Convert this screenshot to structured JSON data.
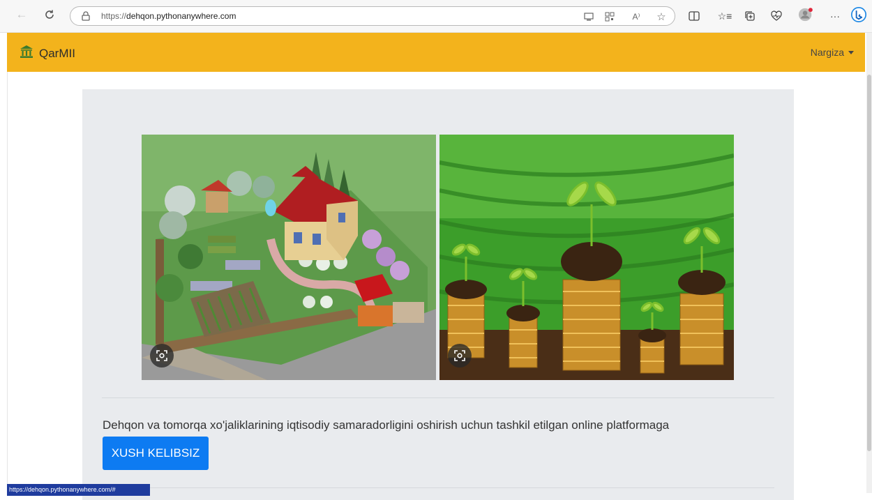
{
  "browser": {
    "url_protocol": "https://",
    "url_host": "dehqon.pythonanywhere.com",
    "icons": [
      "back-icon",
      "refresh-icon",
      "lock-icon",
      "app-available-icon",
      "qr-icon",
      "read-aloud-icon",
      "favorite-star-icon",
      "split-screen-icon",
      "favorites-icon",
      "collections-icon",
      "health-icon",
      "profile-icon",
      "more-icon",
      "bing-icon"
    ],
    "more_label": "···"
  },
  "navbar": {
    "brand_text": "QarMII",
    "brand_icon": "bank-icon",
    "user_name": "Nargiza",
    "bg_color": "#f3b31c"
  },
  "main": {
    "images": [
      {
        "name": "garden-house-image",
        "description_icon": "visual-search-icon"
      },
      {
        "name": "coin-plants-image",
        "description_icon": "visual-search-icon"
      }
    ],
    "tagline": "Dehqon va tomorqa xo'jaliklarining iqtisodiy samaradorligini oshirish uchun tashkil etilgan online platformaga",
    "welcome_button": "XUSH KELIBSIZ",
    "button_color": "#0d7bf2"
  },
  "status_bar": {
    "text": "https://dehqon.pythonanywhere.com/#"
  }
}
